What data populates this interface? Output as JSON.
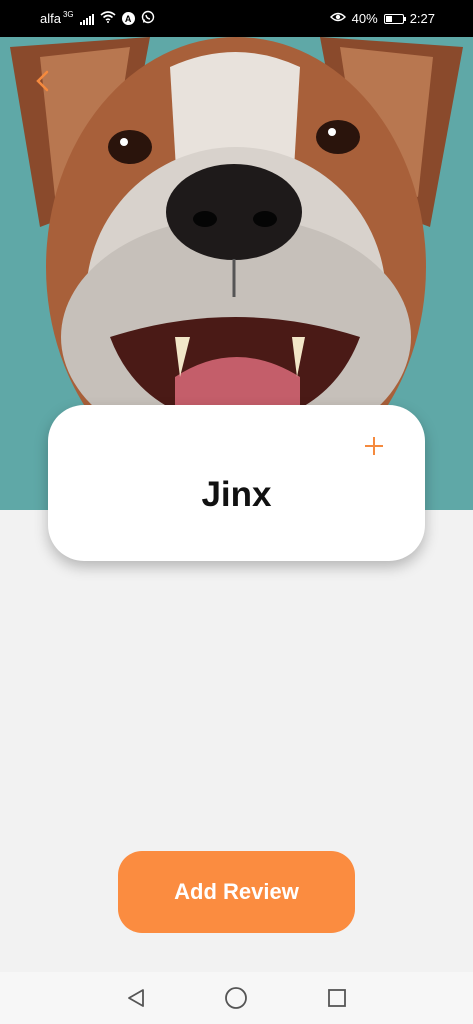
{
  "status_bar": {
    "carrier": "alfa",
    "network": "3G",
    "battery_percent": "40%",
    "battery_level": 0.4,
    "time": "2:27",
    "icons": [
      "signal-icon",
      "wifi-icon",
      "a-badge-icon",
      "whatsapp-icon",
      "eye-icon",
      "battery-icon"
    ]
  },
  "hero": {
    "image": "dog-photo",
    "background_color": "#5fa8a7"
  },
  "pet": {
    "name": "Jinx"
  },
  "actions": {
    "add_review_label": "Add Review"
  },
  "colors": {
    "accent": "#fb8c40",
    "background": "#f2f2f2",
    "card": "#ffffff"
  },
  "nav": {
    "icons": [
      "back-triangle-icon",
      "home-circle-icon",
      "recents-square-icon"
    ]
  }
}
